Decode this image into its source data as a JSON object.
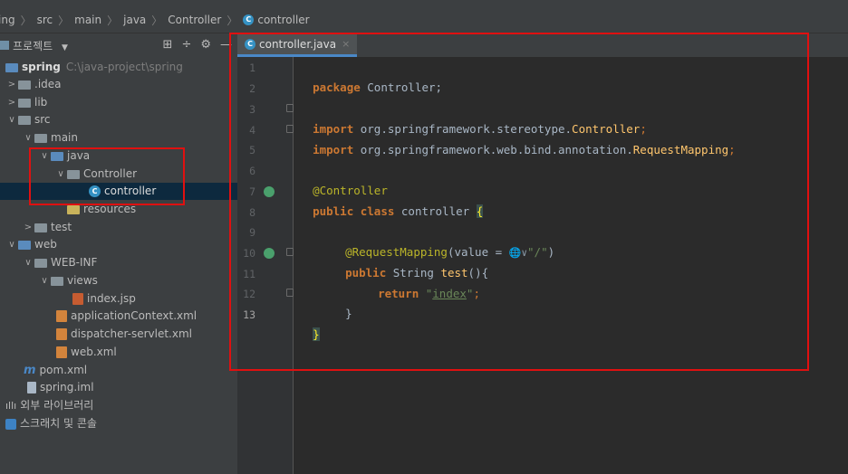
{
  "breadcrumb": {
    "items": [
      "ing",
      "src",
      "main",
      "java",
      "Controller",
      "controller"
    ],
    "class_badge": "C"
  },
  "project": {
    "title": "프로젝트",
    "title_arrow": "▼",
    "icons": [
      "⊞",
      "÷",
      "⚙",
      "—"
    ]
  },
  "tree": {
    "root_name": "spring",
    "root_path": "C:\\java-project\\spring",
    "items": [
      {
        "label": "spring",
        "path": "C:\\java-project\\spring"
      },
      {
        "label": ".idea"
      },
      {
        "label": "lib"
      },
      {
        "label": "src"
      },
      {
        "label": "main"
      },
      {
        "label": "java"
      },
      {
        "label": "Controller"
      },
      {
        "label": "controller"
      },
      {
        "label": "resources"
      },
      {
        "label": "test"
      },
      {
        "label": "web"
      },
      {
        "label": "WEB-INF"
      },
      {
        "label": "views"
      },
      {
        "label": "index.jsp"
      },
      {
        "label": "applicationContext.xml"
      },
      {
        "label": "dispatcher-servlet.xml"
      },
      {
        "label": "web.xml"
      },
      {
        "label": "pom.xml"
      },
      {
        "label": "spring.iml"
      },
      {
        "label": "외부 라이브러리"
      },
      {
        "label": "스크래치 및 콘솔"
      }
    ]
  },
  "tab": {
    "label": "controller.java",
    "close": "×",
    "badge": "C"
  },
  "code": {
    "line_numbers": [
      "1",
      "2",
      "3",
      "4",
      "5",
      "6",
      "7",
      "8",
      "9",
      "10",
      "11",
      "12",
      "13"
    ],
    "l1_kw": "package",
    "l1_rest": " Controller;",
    "l3_kw": "import",
    "l3_pkg": " org.springframework.stereotype.",
    "l3_cls": "Controller",
    "l3_semi": ";",
    "l4_kw": "import",
    "l4_pkg": " org.springframework.web.bind.annotation.",
    "l4_cls": "RequestMapping",
    "l4_semi": ";",
    "l6_ann": "@Controller",
    "l7_kw": "public class",
    "l7_name": " controller ",
    "l7_brace": "{",
    "l9_ann": "@RequestMapping",
    "l9_open": "(value = ",
    "l9_web": "🌐∨",
    "l9_str": "\"/\"",
    "l9_close": ")",
    "l10_kw": "public",
    "l10_type": " String ",
    "l10_fn": "test",
    "l10_rest": "(){",
    "l11_kw": "return",
    "l11_q1": " \"",
    "l11_idx": "index",
    "l11_q2": "\"",
    "l11_semi": ";",
    "l12": "}",
    "l13": "}"
  }
}
